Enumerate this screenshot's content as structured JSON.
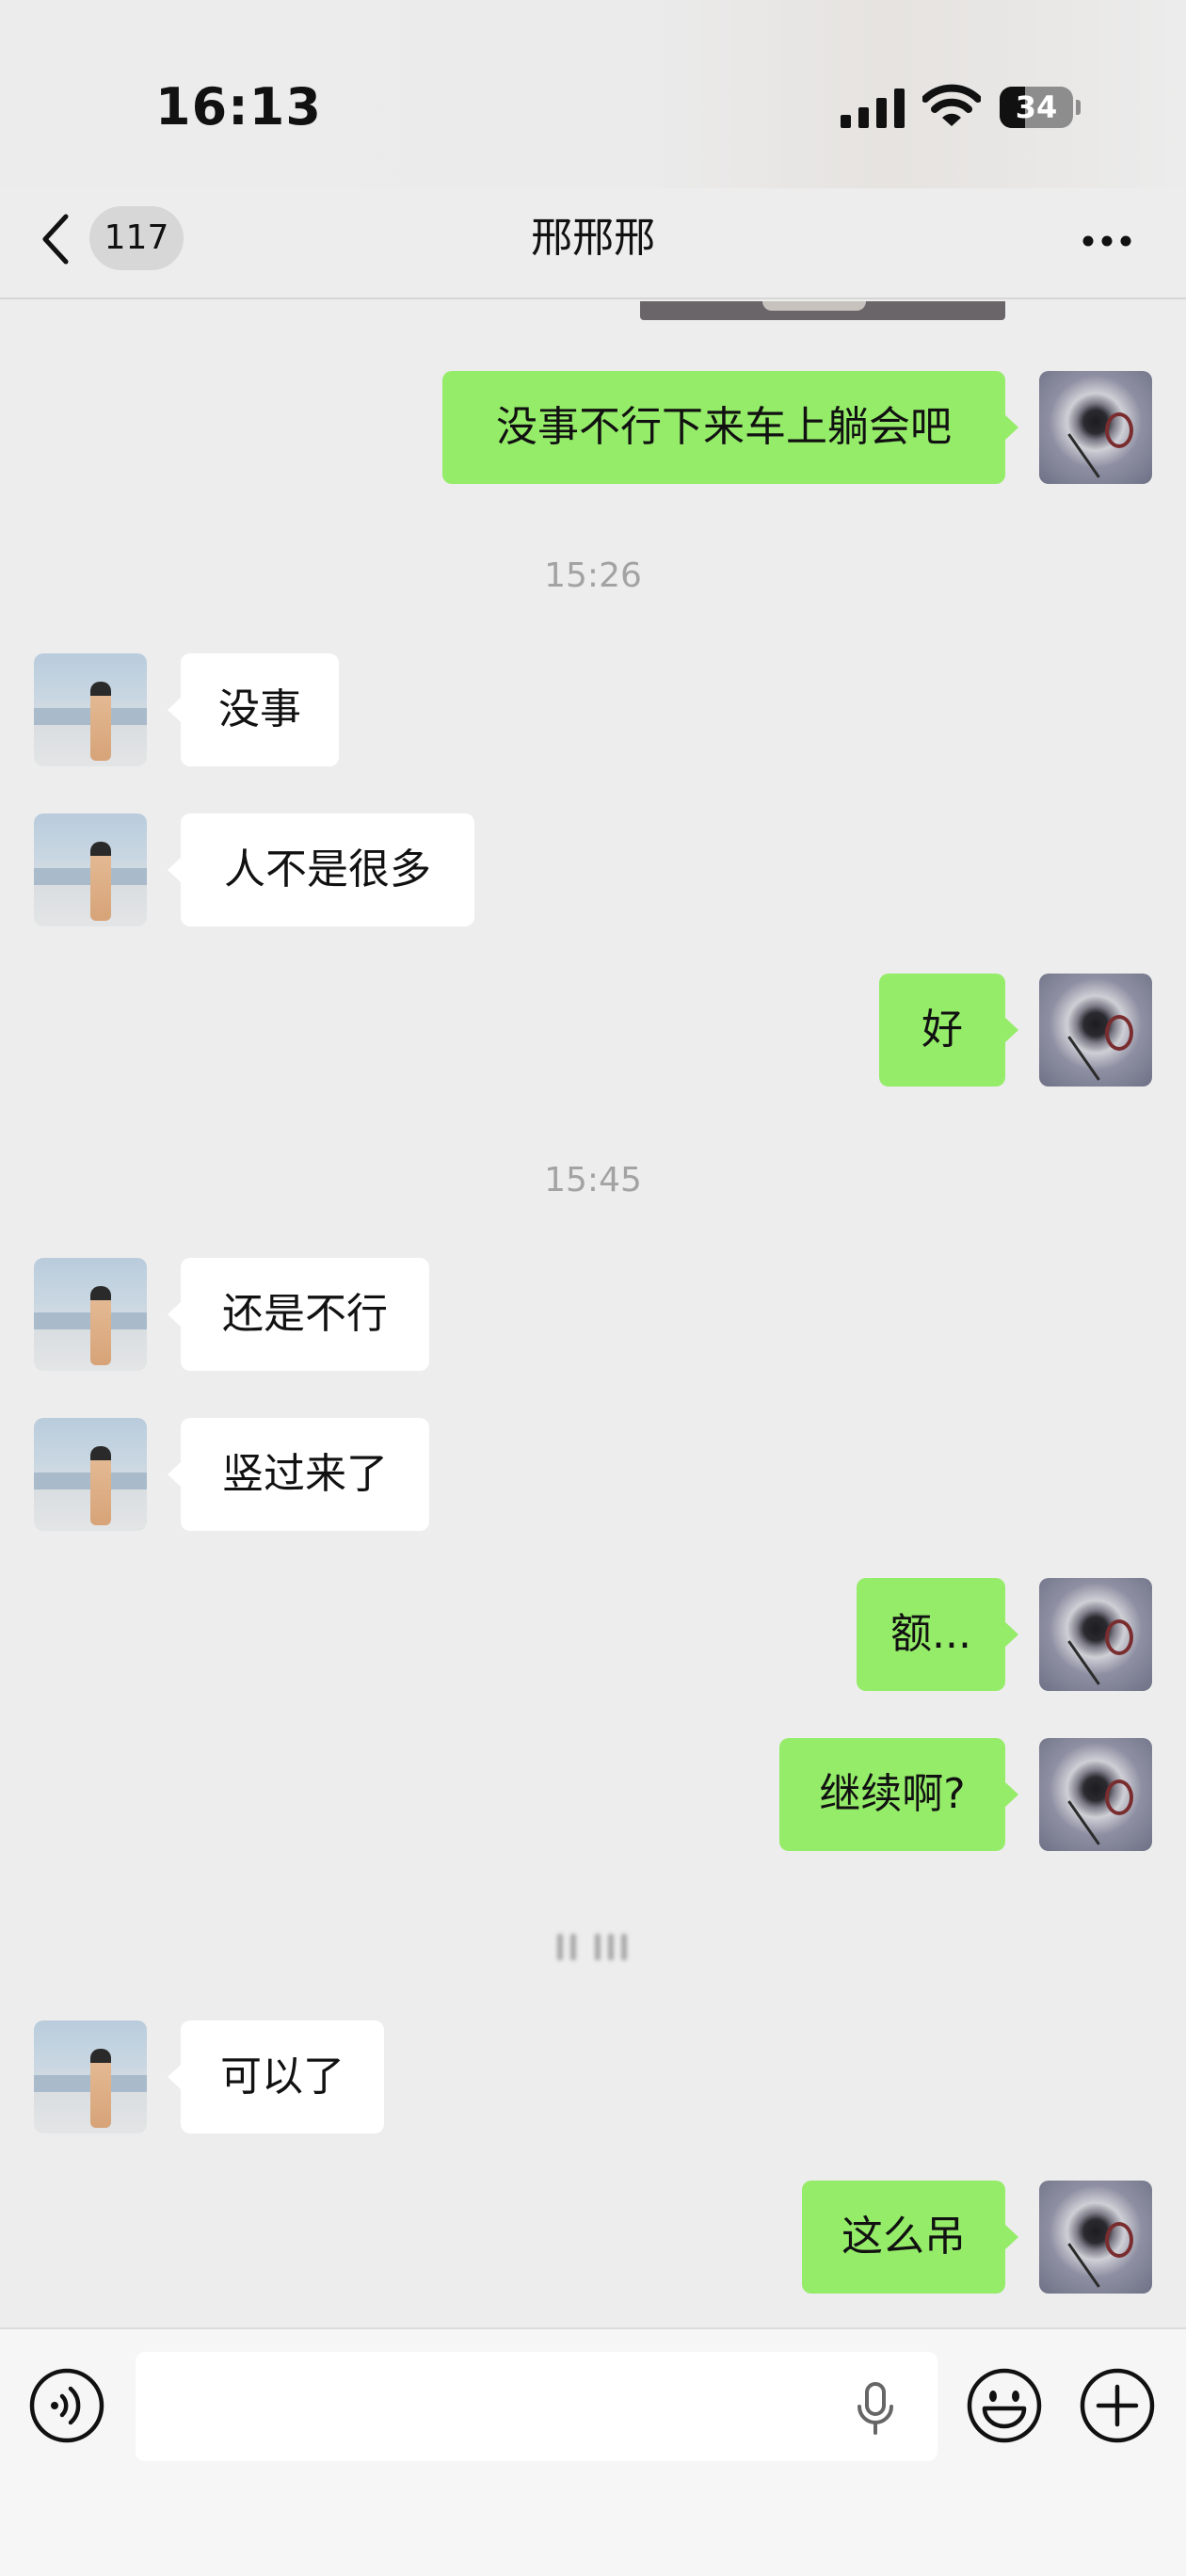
{
  "status_bar": {
    "time": "16:13",
    "battery_level": "34",
    "icons": [
      "cellular-signal-icon",
      "wifi-icon",
      "battery-icon"
    ]
  },
  "header": {
    "unread_count": "117",
    "title": "邢邢邢",
    "icons": [
      "chevron-left-icon",
      "more-icon"
    ]
  },
  "messages": [
    {
      "side": "right",
      "text": "没事不行下来车上躺会吧"
    },
    {
      "type": "time",
      "text": "15:26"
    },
    {
      "side": "left",
      "text": "没事"
    },
    {
      "side": "left",
      "text": "人不是很多"
    },
    {
      "side": "right",
      "text": "好"
    },
    {
      "type": "time",
      "text": "15:45"
    },
    {
      "side": "left",
      "text": "还是不行"
    },
    {
      "side": "left",
      "text": "竖过来了"
    },
    {
      "side": "right",
      "text": "额..."
    },
    {
      "side": "right",
      "text": "继续啊?"
    },
    {
      "type": "time-blurred",
      "text": ""
    },
    {
      "side": "left",
      "text": "可以了"
    },
    {
      "side": "right",
      "text": "这么吊"
    }
  ],
  "input_bar": {
    "value": "",
    "icons": [
      "voice-icon",
      "microphone-icon",
      "emoji-icon",
      "plus-icon"
    ]
  },
  "colors": {
    "background": "#ededed",
    "sent_bubble": "#95ec69",
    "received_bubble": "#ffffff",
    "timestamp": "#a3a3a3"
  }
}
